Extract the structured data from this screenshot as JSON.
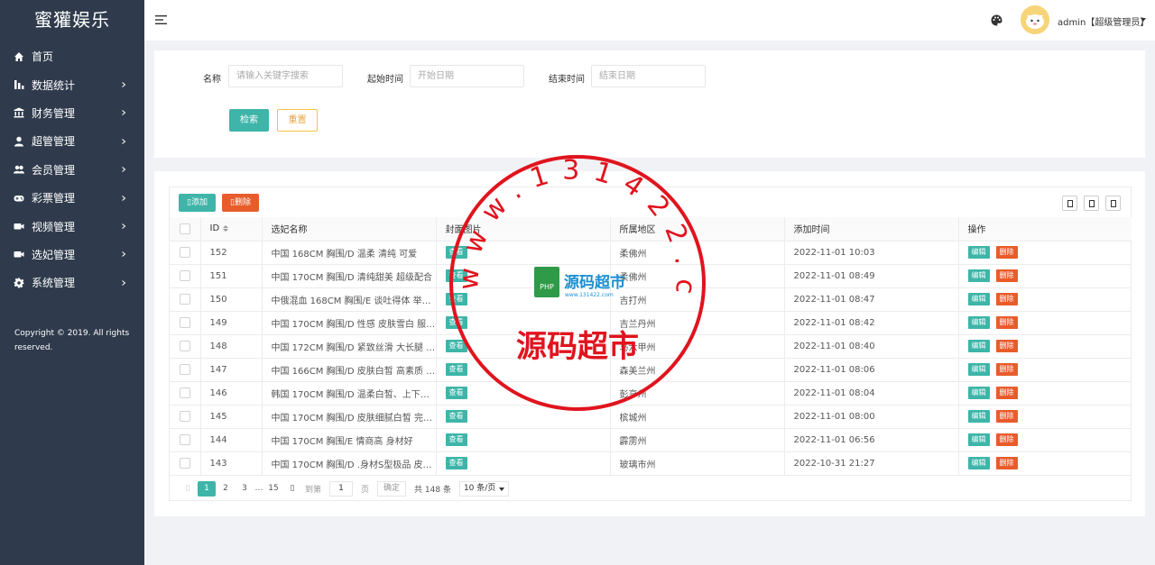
{
  "app": {
    "title": "蜜獾娱乐"
  },
  "sidebar": {
    "items": [
      {
        "label": "首页",
        "icon": "home-icon",
        "has_children": false
      },
      {
        "label": "数据统计",
        "icon": "bar-chart-icon",
        "has_children": true
      },
      {
        "label": "财务管理",
        "icon": "bank-icon",
        "has_children": true
      },
      {
        "label": "超管管理",
        "icon": "user-icon",
        "has_children": true
      },
      {
        "label": "会员管理",
        "icon": "users-icon",
        "has_children": true
      },
      {
        "label": "彩票管理",
        "icon": "gamepad-icon",
        "has_children": true
      },
      {
        "label": "视频管理",
        "icon": "video-icon",
        "has_children": true
      },
      {
        "label": "选妃管理",
        "icon": "video-icon",
        "has_children": true
      },
      {
        "label": "系统管理",
        "icon": "gear-icon",
        "has_children": true
      }
    ],
    "copyright": "Copyright © 2019. All rights reserved."
  },
  "header": {
    "user": "admin【超级管理员】"
  },
  "search": {
    "name_label": "名称",
    "name_placeholder": "请输入关键字搜索",
    "start_label": "起始时间",
    "start_placeholder": "开始日期",
    "end_label": "结束时间",
    "end_placeholder": "结束日期",
    "search_button": "检索",
    "reset_button": "重置"
  },
  "toolbar": {
    "add_label": "添加",
    "delete_label": "删除"
  },
  "table": {
    "columns": [
      "ID",
      "选妃名称",
      "封面图片",
      "所属地区",
      "添加时间",
      "操作"
    ],
    "view_label": "查看",
    "edit_label": "编辑",
    "delete_label": "删除",
    "rows": [
      {
        "id": "152",
        "name": "中国 168CM 胸围/D 温柔 清纯 可爱",
        "region": "柔佛州",
        "time": "2022-11-01 10:03"
      },
      {
        "id": "151",
        "name": "中国 170CM 胸围/D 清纯甜美 超级配合",
        "region": "柔佛州",
        "time": "2022-11-01 08:49"
      },
      {
        "id": "150",
        "name": "中俄混血 168CM 胸围/E 谈吐得体 举止…",
        "region": "吉打州",
        "time": "2022-11-01 08:47"
      },
      {
        "id": "149",
        "name": "中国 170CM 胸围/D 性感 皮肤雪白 服…",
        "region": "吉兰丹州",
        "time": "2022-11-01 08:42"
      },
      {
        "id": "148",
        "name": "中国 172CM 胸围/D 紧致丝滑 大长腿 …",
        "region": "马六甲州",
        "time": "2022-11-01 08:40"
      },
      {
        "id": "147",
        "name": "中国 166CM 胸围/D 皮肤白皙 高素质 …",
        "region": "森美兰州",
        "time": "2022-11-01 08:06"
      },
      {
        "id": "146",
        "name": "韩国 170CM 胸围/D 温柔白皙、上下粉…",
        "region": "彭亨州",
        "time": "2022-11-01 08:04"
      },
      {
        "id": "145",
        "name": "中国 170CM 胸围/D 皮肤细腻白皙 完美…",
        "region": "槟城州",
        "time": "2022-11-01 08:00"
      },
      {
        "id": "144",
        "name": "中国 170CM 胸围/E 情商高 身材好",
        "region": "霹雳州",
        "time": "2022-11-01 06:56"
      },
      {
        "id": "143",
        "name": "中国 170CM 胸围/D .身材S型极品 皮肤…",
        "region": "玻璃市州",
        "time": "2022-10-31 21:27"
      }
    ]
  },
  "pagination": {
    "pages": [
      "1",
      "2",
      "3",
      "…",
      "15"
    ],
    "current": "1",
    "goto_label": "到第",
    "goto_value": "1",
    "page_suffix": "页",
    "confirm_label": "确定",
    "total": "共 148 条",
    "page_size": "10 条/页"
  },
  "watermark": {
    "ring_text": "www.131422.com",
    "center_text": "源码超市",
    "logo_text": "源码超市",
    "logo_sub": "www.131422.com"
  },
  "colors": {
    "sidebar_bg": "#2f3b4c",
    "accent": "#3eb5a8",
    "danger": "#e85c2c",
    "warning": "#f5c342",
    "stamp": "#e0141e"
  }
}
